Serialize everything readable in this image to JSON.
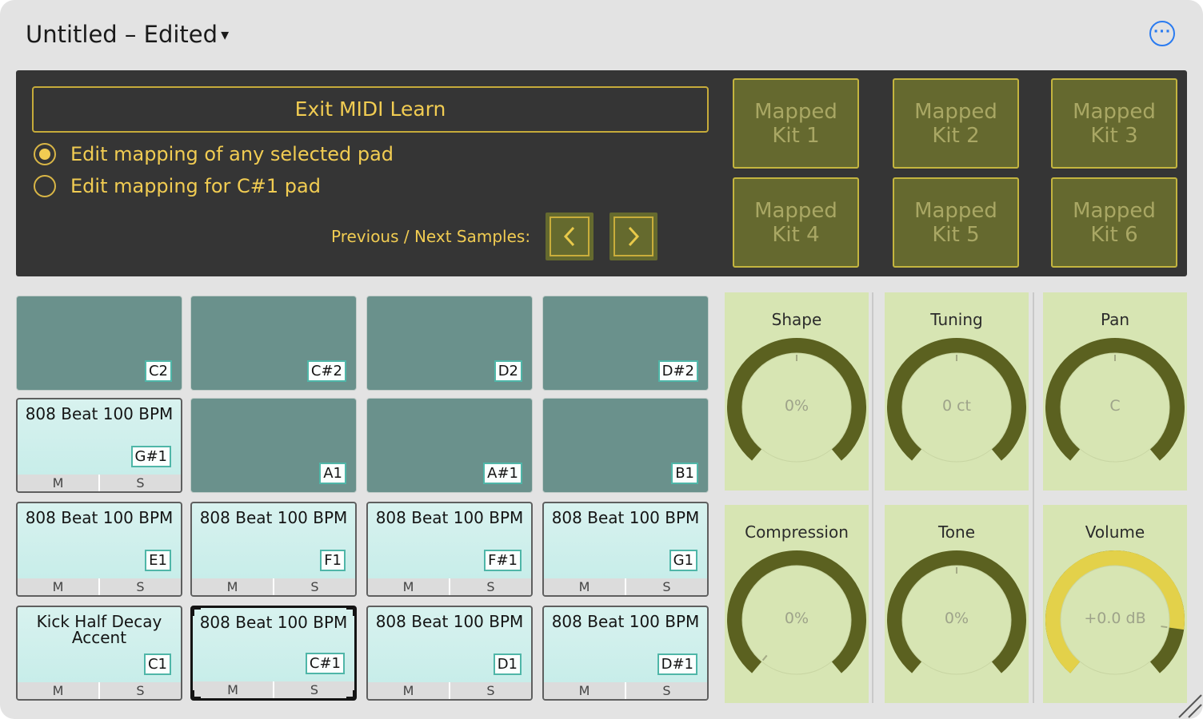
{
  "window": {
    "title": "Untitled – Edited",
    "title_caret": "▾",
    "more_icon": "ellipsis-icon"
  },
  "midi": {
    "exit_label": "Exit MIDI Learn",
    "radio_any": "Edit mapping of any selected pad",
    "radio_pad": "Edit mapping for C#1 pad",
    "selected_radio": "any",
    "prev_next_label": "Previous / Next Samples:",
    "kits": [
      {
        "line1": "Mapped",
        "line2": "Kit 1"
      },
      {
        "line1": "Mapped",
        "line2": "Kit 2"
      },
      {
        "line1": "Mapped",
        "line2": "Kit 3"
      },
      {
        "line1": "Mapped",
        "line2": "Kit 4"
      },
      {
        "line1": "Mapped",
        "line2": "Kit 5"
      },
      {
        "line1": "Mapped",
        "line2": "Kit 6"
      }
    ]
  },
  "pads": [
    {
      "note": "C2",
      "sample": "",
      "mute": "",
      "solo": ""
    },
    {
      "note": "C#2",
      "sample": "",
      "mute": "",
      "solo": ""
    },
    {
      "note": "D2",
      "sample": "",
      "mute": "",
      "solo": ""
    },
    {
      "note": "D#2",
      "sample": "",
      "mute": "",
      "solo": ""
    },
    {
      "note": "G#1",
      "sample": "808 Beat 100 BPM",
      "mute": "M",
      "solo": "S"
    },
    {
      "note": "A1",
      "sample": "",
      "mute": "",
      "solo": ""
    },
    {
      "note": "A#1",
      "sample": "",
      "mute": "",
      "solo": ""
    },
    {
      "note": "B1",
      "sample": "",
      "mute": "",
      "solo": ""
    },
    {
      "note": "E1",
      "sample": "808 Beat 100 BPM",
      "mute": "M",
      "solo": "S"
    },
    {
      "note": "F1",
      "sample": "808 Beat 100 BPM",
      "mute": "M",
      "solo": "S"
    },
    {
      "note": "F#1",
      "sample": "808 Beat 100 BPM",
      "mute": "M",
      "solo": "S"
    },
    {
      "note": "G1",
      "sample": "808 Beat 100 BPM",
      "mute": "M",
      "solo": "S"
    },
    {
      "note": "C1",
      "sample": "Kick Half Decay Accent",
      "mute": "M",
      "solo": "S"
    },
    {
      "note": "C#1",
      "sample": "808 Beat 100 BPM",
      "mute": "M",
      "solo": "S"
    },
    {
      "note": "D1",
      "sample": "808 Beat 100 BPM",
      "mute": "M",
      "solo": "S"
    },
    {
      "note": "D#1",
      "sample": "808 Beat 100 BPM",
      "mute": "M",
      "solo": "S"
    }
  ],
  "selected_pad": "C#1",
  "knobs": [
    {
      "title": "Shape",
      "value": "0%",
      "fill_fraction": 0,
      "bipolar": true
    },
    {
      "title": "Tuning",
      "value": "0 ct",
      "fill_fraction": 0,
      "bipolar": true
    },
    {
      "title": "Pan",
      "value": "C",
      "fill_fraction": 0,
      "bipolar": true
    },
    {
      "title": "Compression",
      "value": "0%",
      "fill_fraction": 0,
      "bipolar": false
    },
    {
      "title": "Tone",
      "value": "0%",
      "fill_fraction": 0,
      "bipolar": true
    },
    {
      "title": "Volume",
      "value": "+0.0 dB",
      "fill_fraction": 0.85,
      "bipolar": false
    }
  ],
  "colors": {
    "accent_yellow": "#f1cc52",
    "knob_track": "#5b6120",
    "knob_fill": "#e3d14a",
    "pad_empty": "#6a918c",
    "pad_loaded": "#d0efec"
  }
}
